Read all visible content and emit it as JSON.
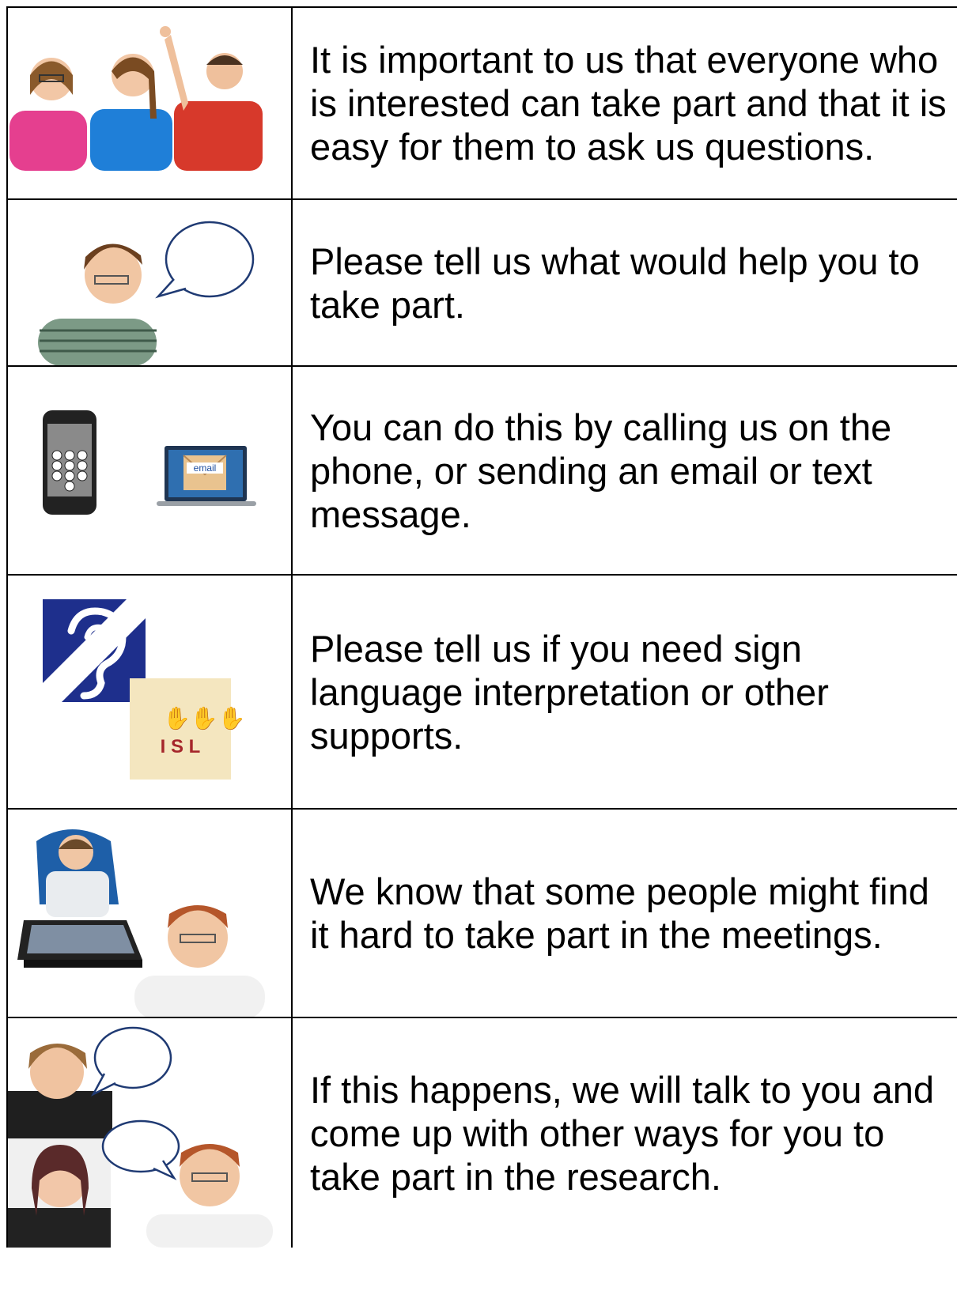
{
  "rows": [
    {
      "id": "take-part",
      "text": "It is important to us that everyone who is interested can take part and that it is easy for them to ask us questions.",
      "icon": "three-young-people-icon"
    },
    {
      "id": "tell-us",
      "text": "Please tell us what would help you to take part.",
      "icon": "person-speech-bubble-icon"
    },
    {
      "id": "contact",
      "text": "You can do this by calling us on the phone, or sending an email or text message.",
      "icon": "phone-and-laptop-email-icon"
    },
    {
      "id": "sign-language",
      "text": "Please tell us if you need sign language interpretation or other supports.",
      "icon": "hearing-loop-and-isl-icon",
      "isl_label": "I S L"
    },
    {
      "id": "hard-to-take-part",
      "text": "We know that some people might find it hard to take part in the meetings.",
      "icon": "wheelchair-user-and-young-man-icon"
    },
    {
      "id": "other-ways",
      "text": "If this happens, we will talk to you and come up with other ways for you to take part in the research.",
      "icon": "people-talking-icon"
    }
  ],
  "email_label": "email",
  "colors": {
    "border": "#000000",
    "hearing_blue": "#1e2f8c",
    "isl_bg": "#f4e6bf",
    "bubble": "#1f3a73"
  }
}
